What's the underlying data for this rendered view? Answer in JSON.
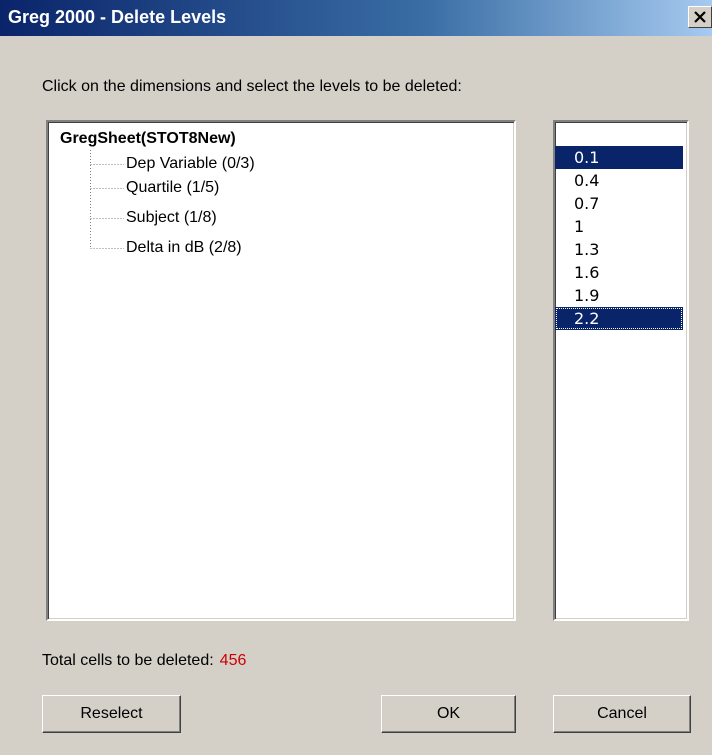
{
  "window": {
    "title": "Greg 2000 - Delete Levels",
    "close_icon": "close-icon"
  },
  "instruction": "Click on the dimensions and select the levels to be deleted:",
  "tree": {
    "root": "GregSheet(STOT8New)",
    "children": [
      {
        "label": "Dep Variable  (0/3)"
      },
      {
        "label": "Quartile  (1/5)"
      },
      {
        "label": "Subject  (1/8)"
      },
      {
        "label": "Delta in dB  (2/8)"
      }
    ]
  },
  "levels": {
    "items": [
      {
        "label": "0.1",
        "selected": true
      },
      {
        "label": "0.4",
        "selected": false
      },
      {
        "label": "0.7",
        "selected": false
      },
      {
        "label": "1",
        "selected": false
      },
      {
        "label": "1.3",
        "selected": false
      },
      {
        "label": "1.6",
        "selected": false
      },
      {
        "label": "1.9",
        "selected": false
      },
      {
        "label": "2.2",
        "selected": true,
        "focused": true
      }
    ]
  },
  "total": {
    "label": "Total cells to be deleted:",
    "value": "456",
    "value_color": "#cc0000"
  },
  "buttons": {
    "reselect": "Reselect",
    "ok": "OK",
    "cancel": "Cancel"
  },
  "colors": {
    "titlebar_start": "#0a246a",
    "titlebar_end": "#a6caf0",
    "selection": "#0a246a",
    "dialog_bg": "#d4d0c8"
  }
}
